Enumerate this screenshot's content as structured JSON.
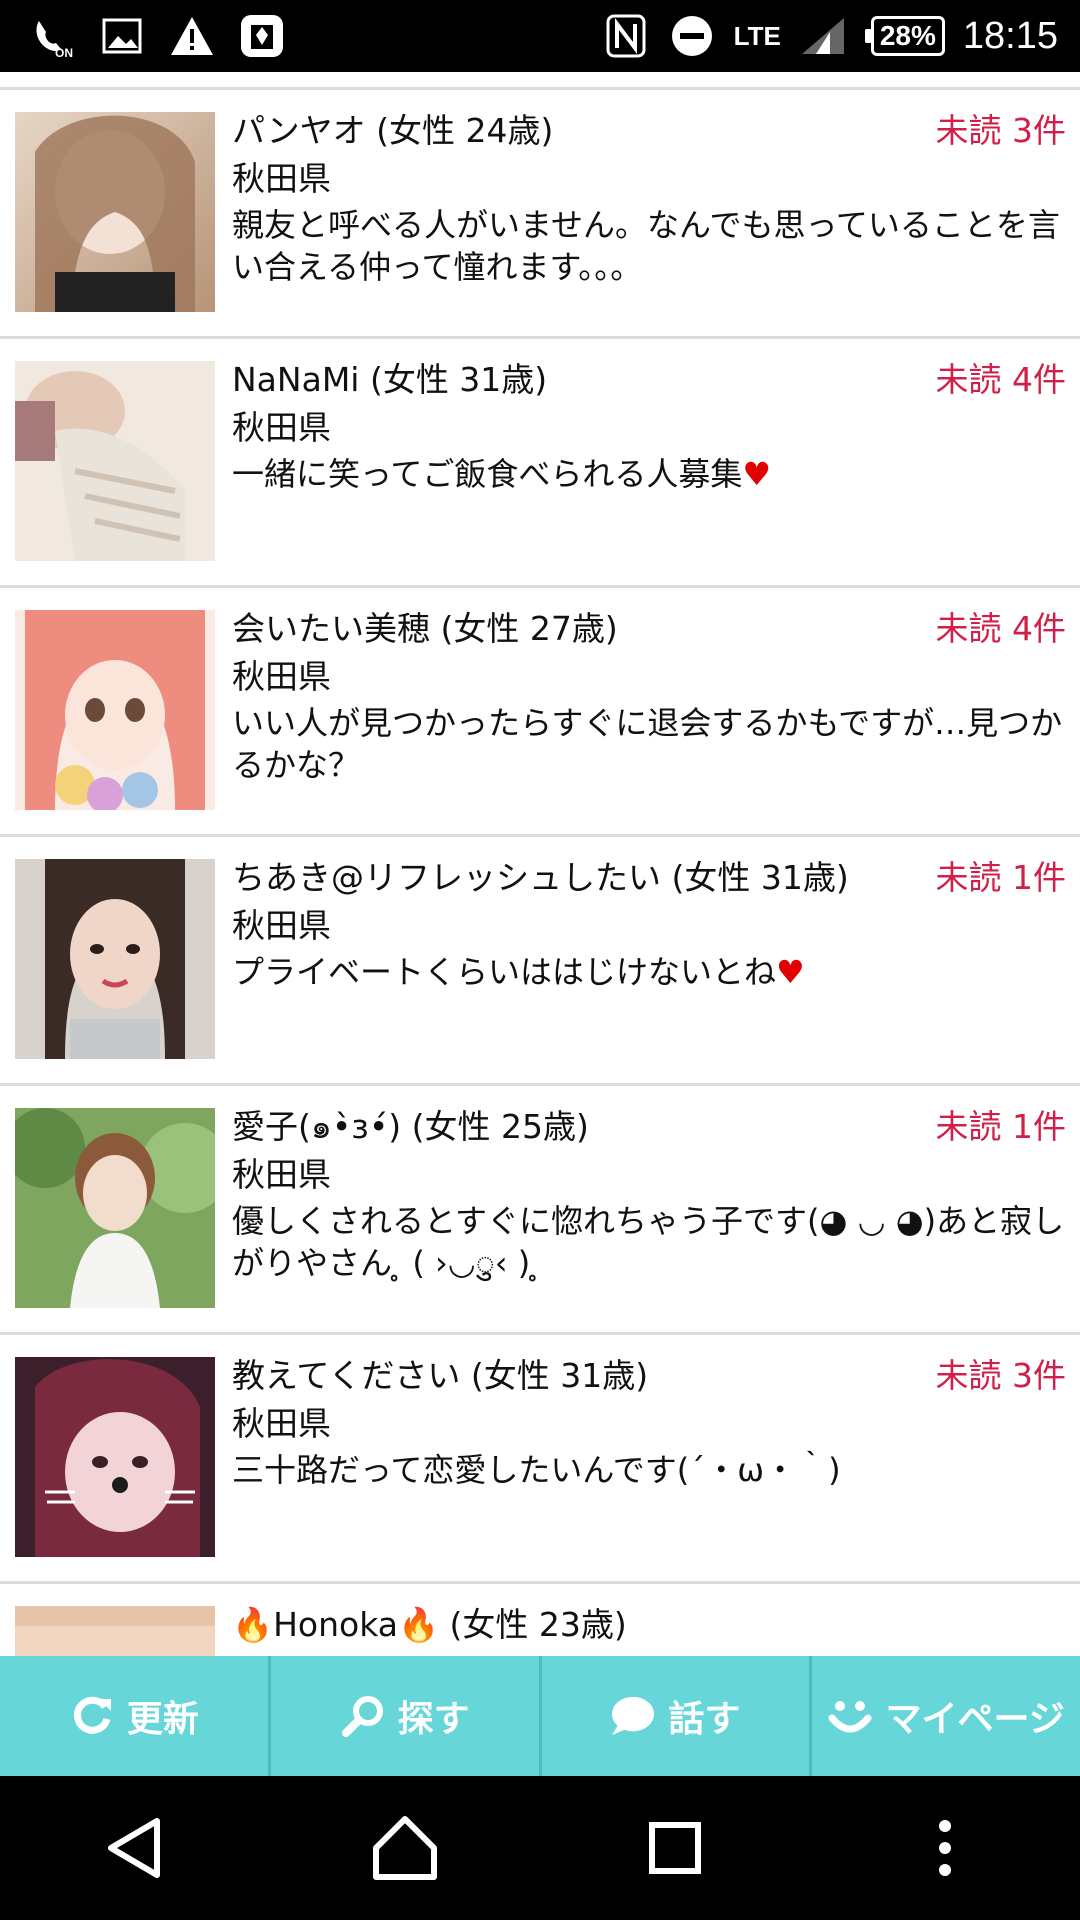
{
  "status_bar": {
    "network_label": "LTE",
    "battery_text": "28%",
    "time": "18:15"
  },
  "list": [
    {
      "name": "パンヤオ (女性 24歳)",
      "unread": "未読 3件",
      "prefecture": "秋田県",
      "message": "親友と呼べる人がいません。なんでも思っていることを言い合える仲って憧れます。。。",
      "avatar_colors": [
        "#d9c2ad",
        "#8a6a52"
      ]
    },
    {
      "name": "NaNaMi (女性 31歳)",
      "unread": "未読 4件",
      "prefecture": "秋田県",
      "message": "一緒に笑ってご飯食べられる人募集",
      "heart": "♥",
      "avatar_colors": [
        "#f1e6dc",
        "#c7b39e"
      ]
    },
    {
      "name": "会いたい美穂 (女性 27歳)",
      "unread": "未読 4件",
      "prefecture": "秋田県",
      "message": "いい人が見つかったらすぐに退会するかもですが…見つかるかな？",
      "avatar_colors": [
        "#f5b7a8",
        "#e36f6a"
      ]
    },
    {
      "name": "ちあき@リフレッシュしたい (女性 31歳)",
      "unread": "未読 1件",
      "prefecture": "秋田県",
      "message": "プライベートくらいははじけないとね",
      "heart": "♥",
      "avatar_colors": [
        "#cfc9c4",
        "#3b2e2a"
      ]
    },
    {
      "name": "愛子(๑•̀ɜ•́) (女性 25歳)",
      "unread": "未読 1件",
      "prefecture": "秋田県",
      "message": "優しくされるとすぐに惚れちゃう子です(◕ ◡ ◕)あと寂しがりやさん ̥ ( ›◡ु‹ ) ̥",
      "avatar_colors": [
        "#8fb56e",
        "#e9ece6"
      ]
    },
    {
      "name": "教えてください (女性 31歳)",
      "unread": "未読 3件",
      "prefecture": "秋田県",
      "message": "三十路だって恋愛したいんです(´・ω・｀)",
      "avatar_colors": [
        "#6b2a3a",
        "#e6c4c6"
      ]
    },
    {
      "name_prefix_icon": "🔥",
      "name": "Honoka",
      "name_suffix_icon": "🔥",
      "name_rest": " (女性 23歳)",
      "avatar_colors": [
        "#f2d6c2",
        "#e7c3a8"
      ]
    }
  ],
  "tabs": [
    {
      "label": "更新",
      "icon": "refresh-icon"
    },
    {
      "label": "探す",
      "icon": "search-icon"
    },
    {
      "label": "話す",
      "icon": "chat-bubble-icon"
    },
    {
      "label": "マイページ",
      "icon": "smile-icon"
    }
  ],
  "nav": [
    "back-icon",
    "home-icon",
    "recents-icon",
    "more-icon"
  ],
  "colors": {
    "unread": "#d0204a",
    "tab_bar": "#66d6d8",
    "separator": "#dcdcdc"
  }
}
